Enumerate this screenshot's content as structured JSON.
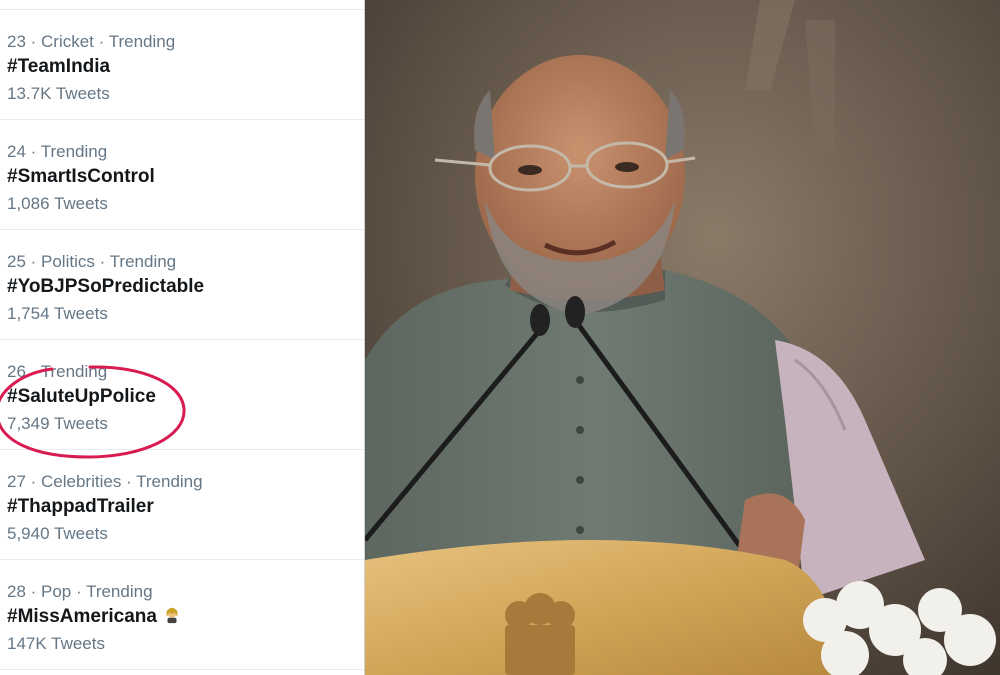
{
  "trends": [
    {
      "meta": "23 · Cricket · Trending",
      "tag": "#TeamIndia",
      "count": "13.7K Tweets"
    },
    {
      "meta": "24 · Trending",
      "tag": "#SmartIsControl",
      "count": "1,086 Tweets"
    },
    {
      "meta": "25 · Politics · Trending",
      "tag": "#YoBJPSoPredictable",
      "count": "1,754 Tweets"
    },
    {
      "meta": "26 · Trending",
      "tag": "#SaluteUpPolice",
      "count": "7,349 Tweets"
    },
    {
      "meta": "27 · Celebrities · Trending",
      "tag": "#ThappadTrailer",
      "count": "5,940 Tweets"
    },
    {
      "meta": "28 · Pop · Trending",
      "tag": "#MissAmericana",
      "count": "147K Tweets"
    }
  ],
  "colors": {
    "meta_text": "#657786",
    "tag_text": "#14171a",
    "divider": "#e6ecf0",
    "highlight": "#d81b50"
  },
  "icons": {
    "highlight": "red-circle-annotation",
    "emoji": "pop-star-emoji"
  }
}
